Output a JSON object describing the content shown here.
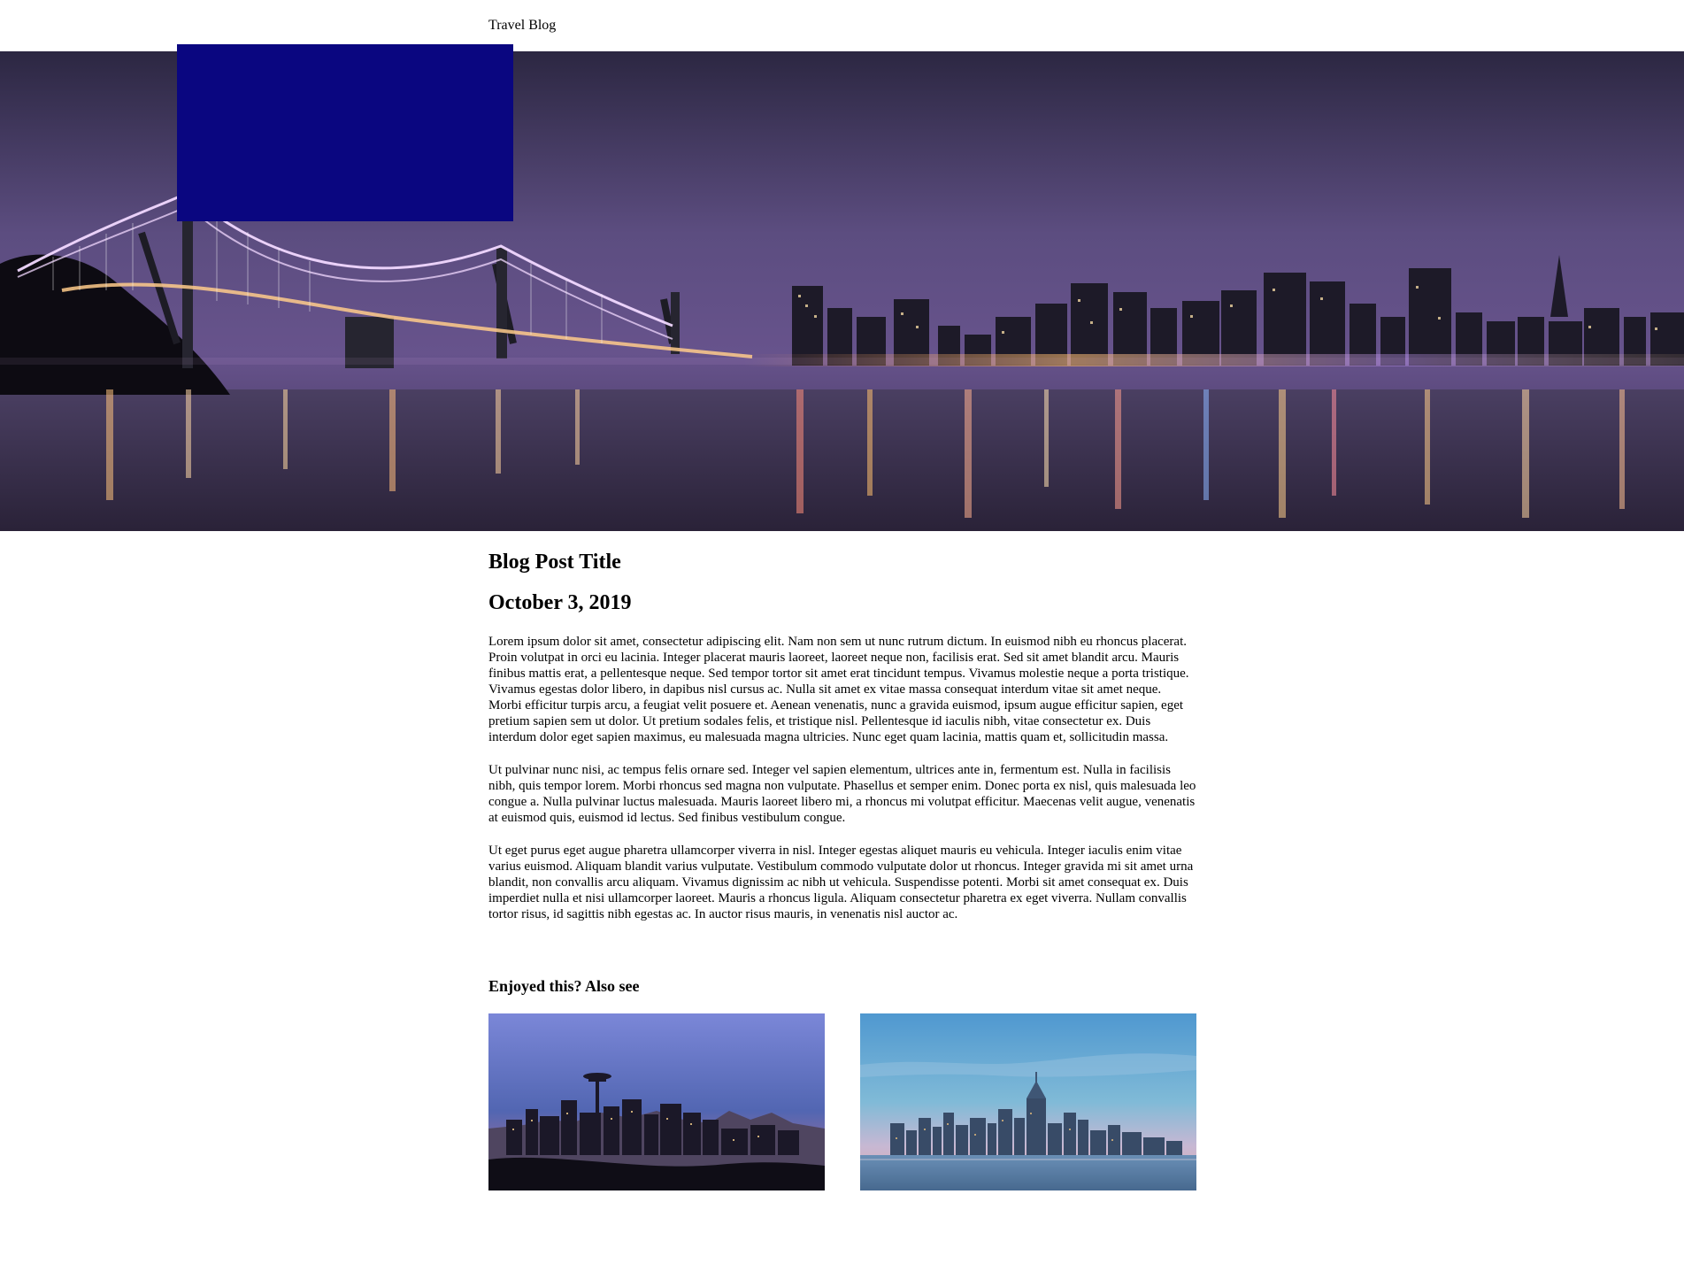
{
  "header": {
    "brand": "Travel Blog"
  },
  "post": {
    "title": "Blog Post Title",
    "date": "October 3, 2019",
    "paragraphs": [
      "Lorem ipsum dolor sit amet, consectetur adipiscing elit. Nam non sem ut nunc rutrum dictum. In euismod nibh eu rhoncus placerat. Proin volutpat in orci eu lacinia. Integer placerat mauris laoreet, laoreet neque non, facilisis erat. Sed sit amet blandit arcu. Mauris finibus mattis erat, a pellentesque neque. Sed tempor tortor sit amet erat tincidunt tempus. Vivamus molestie neque a porta tristique. Vivamus egestas dolor libero, in dapibus nisl cursus ac. Nulla sit amet ex vitae massa consequat interdum vitae sit amet neque. Morbi efficitur turpis arcu, a feugiat velit posuere et. Aenean venenatis, nunc a gravida euismod, ipsum augue efficitur sapien, eget pretium sapien sem ut dolor. Ut pretium sodales felis, et tristique nisl. Pellentesque id iaculis nibh, vitae consectetur ex. Duis interdum dolor eget sapien maximus, eu malesuada magna ultricies. Nunc eget quam lacinia, mattis quam et, sollicitudin massa.",
      "Ut pulvinar nunc nisi, ac tempus felis ornare sed. Integer vel sapien elementum, ultrices ante in, fermentum est. Nulla in facilisis nibh, quis tempor lorem. Morbi rhoncus sed magna non vulputate. Phasellus et semper enim. Donec porta ex nisl, quis malesuada leo congue a. Nulla pulvinar luctus malesuada. Mauris laoreet libero mi, a rhoncus mi volutpat efficitur. Maecenas velit augue, venenatis at euismod quis, euismod id lectus. Sed finibus vestibulum congue.",
      "Ut eget purus eget augue pharetra ullamcorper viverra in nisl. Integer egestas aliquet mauris eu vehicula. Integer iaculis enim vitae varius euismod. Aliquam blandit varius vulputate. Vestibulum commodo vulputate dolor ut rhoncus. Integer gravida mi sit amet urna blandit, non convallis arcu aliquam. Vivamus dignissim ac nibh ut vehicula. Suspendisse potenti. Morbi sit amet consequat ex. Duis imperdiet nulla et nisi ullamcorper laoreet. Mauris a rhoncus ligula. Aliquam consectetur pharetra ex eget viverra. Nullam convallis tortor risus, id sagittis nibh egestas ac. In auctor risus mauris, in venenatis nisl auctor ac."
    ]
  },
  "related": {
    "heading": "Enjoyed this? Also see",
    "items": [
      {
        "image": "seattle-skyline-thumbnail"
      },
      {
        "image": "new-york-skyline-thumbnail"
      }
    ]
  },
  "hero": {
    "image": "san-francisco-bay-bridge-night-skyline",
    "overlay_color": "#0a0680"
  }
}
